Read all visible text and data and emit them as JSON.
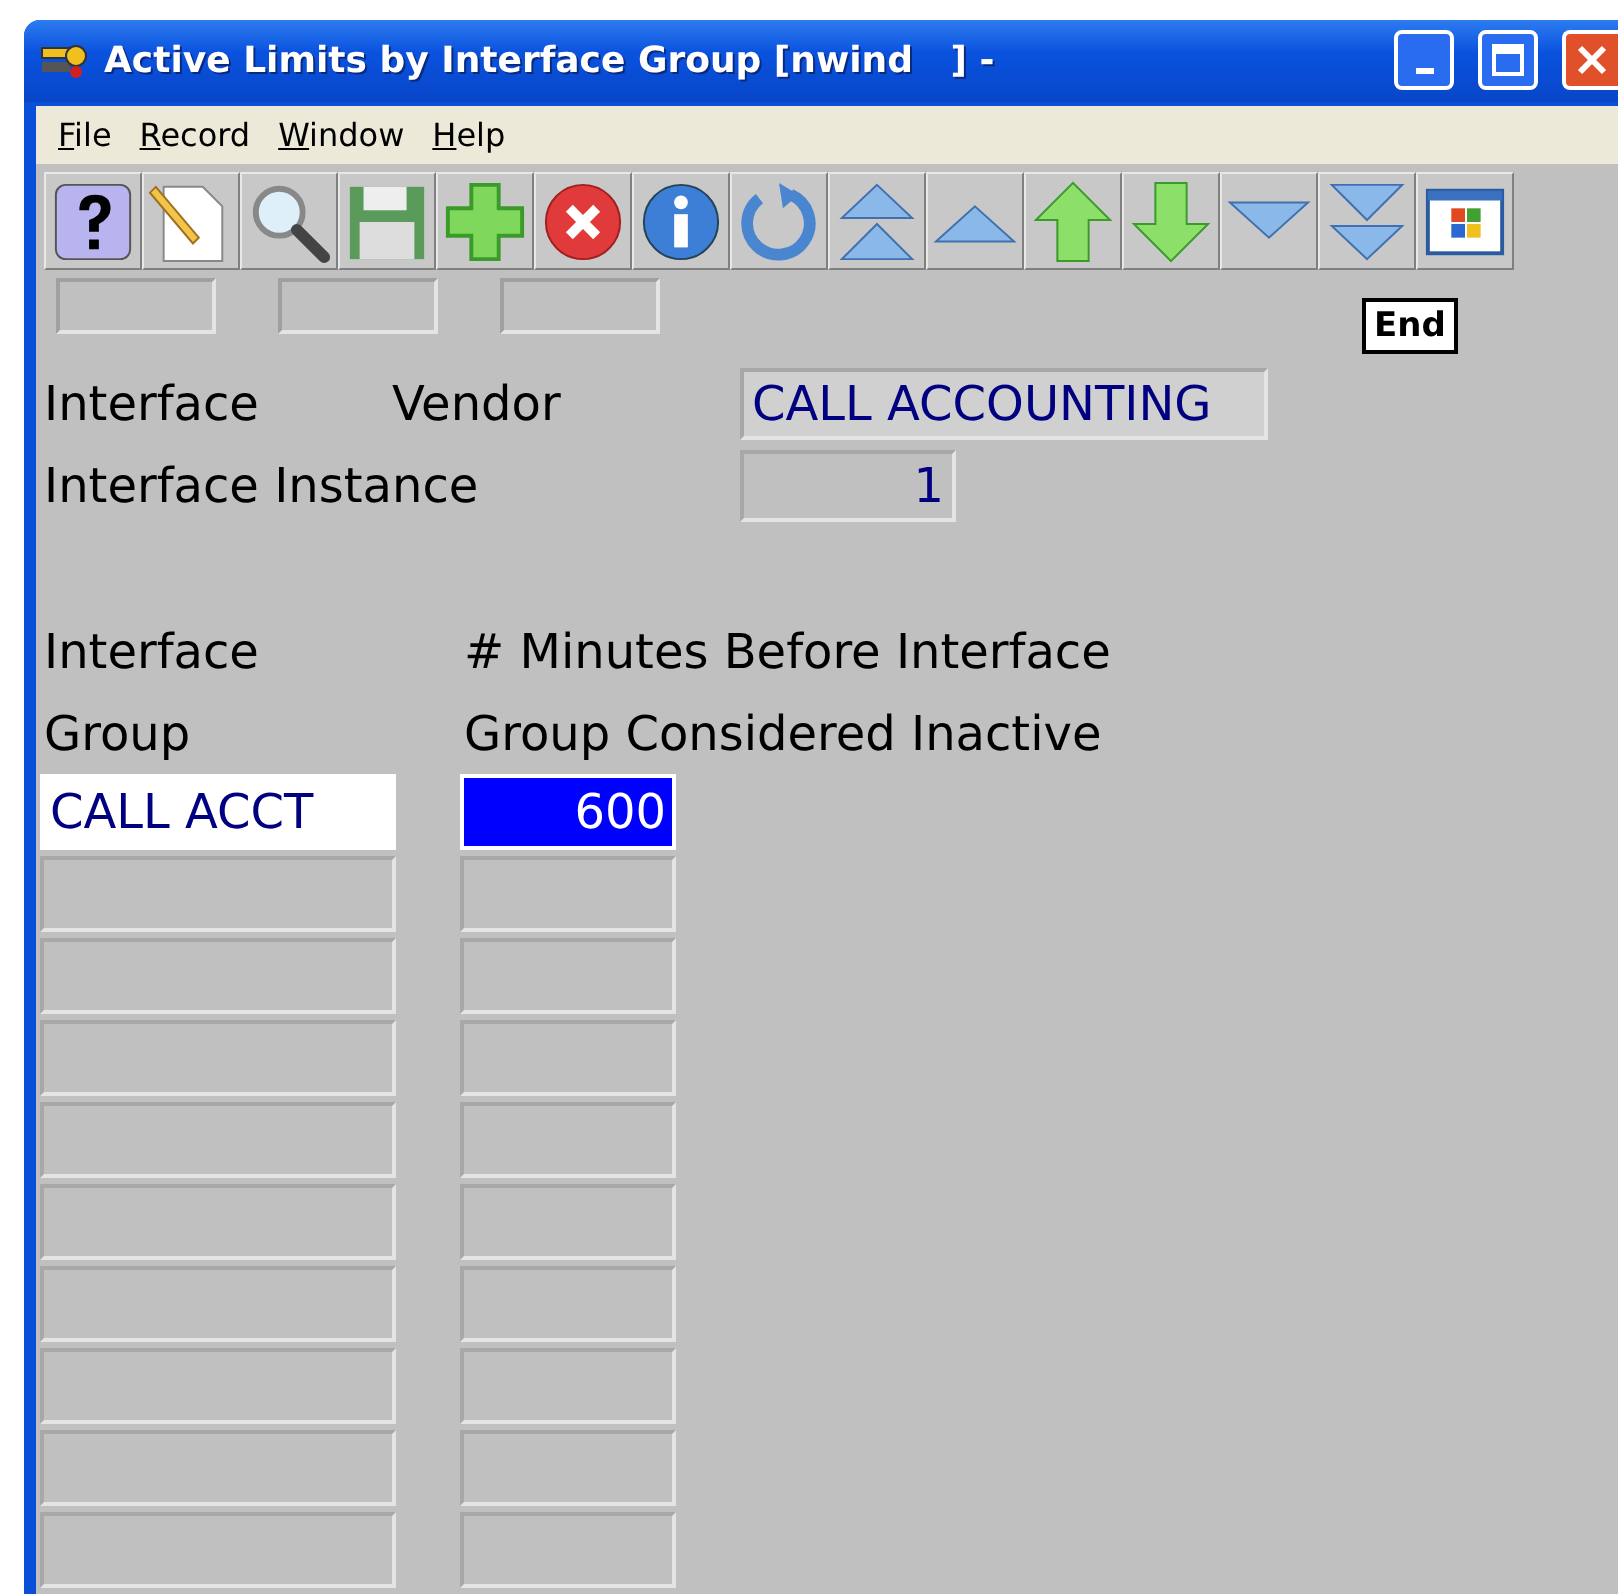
{
  "window": {
    "title": "Active Limits by Interface Group [nwind   ] -"
  },
  "menu": [
    {
      "label": "File"
    },
    {
      "label": "Record"
    },
    {
      "label": "Window"
    },
    {
      "label": "Help"
    }
  ],
  "toolbar": [
    {
      "kind": "help"
    },
    {
      "kind": "new"
    },
    {
      "kind": "search"
    },
    {
      "kind": "save"
    },
    {
      "kind": "add"
    },
    {
      "kind": "delete"
    },
    {
      "kind": "info"
    },
    {
      "kind": "refresh"
    },
    {
      "kind": "first"
    },
    {
      "kind": "prev"
    },
    {
      "kind": "up"
    },
    {
      "kind": "down"
    },
    {
      "kind": "next"
    },
    {
      "kind": "last"
    },
    {
      "kind": "windows"
    }
  ],
  "end_label": "End",
  "header": {
    "vendor_label_1": "Interface",
    "vendor_label_2": "Vendor",
    "vendor": "CALL ACCOUNTING",
    "instance_label": "Interface Instance",
    "instance": "1"
  },
  "columns": [
    {
      "line1": "Interface",
      "line2": "Group"
    },
    {
      "line1": "# Minutes Before Interface",
      "line2": "Group Considered Inactive"
    }
  ],
  "rows": [
    {
      "group": "CALL ACCT",
      "minutes": "600",
      "selected": true
    },
    {
      "selected": false
    },
    {
      "selected": false
    },
    {
      "selected": false
    },
    {
      "selected": false
    },
    {
      "selected": false
    },
    {
      "selected": false
    },
    {
      "selected": false
    },
    {
      "selected": false
    },
    {
      "selected": false
    }
  ]
}
